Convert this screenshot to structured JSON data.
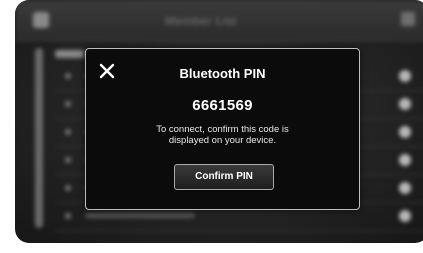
{
  "background": {
    "header_title": "Member List"
  },
  "dialog": {
    "title": "Bluetooth PIN",
    "pin": "6661569",
    "message_line1": "To connect, confirm this code is",
    "message_line2": "displayed on your device.",
    "confirm_label": "Confirm PIN",
    "close_icon": "close-icon"
  },
  "colors": {
    "dialog_bg": "#0b0b0b",
    "dialog_border": "#bdbdbd",
    "text": "#ffffff",
    "screen_bg": "#262626"
  }
}
